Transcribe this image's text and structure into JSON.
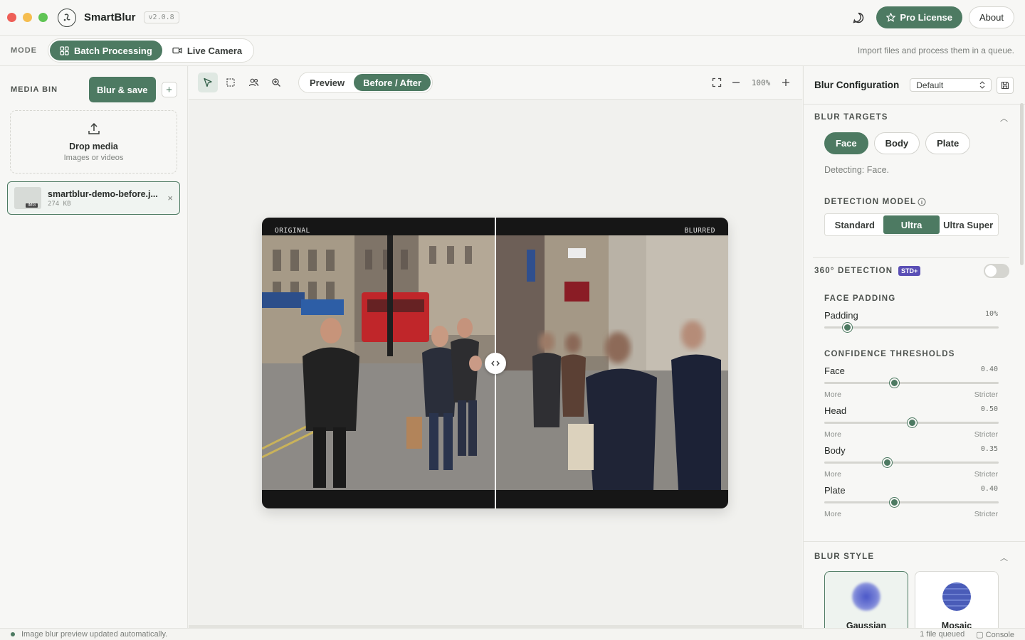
{
  "app": {
    "title": "SmartBlur",
    "version": "v2.0.8"
  },
  "titlebar": {
    "pro_label": "Pro License",
    "about_label": "About"
  },
  "mode": {
    "label": "MODE",
    "tabs": [
      {
        "label": "Batch Processing",
        "active": true
      },
      {
        "label": "Live Camera",
        "active": false
      }
    ],
    "hint": "Import files and process them in a queue."
  },
  "media_bin": {
    "label": "MEDIA BIN",
    "blur_save_label": "Blur & save",
    "add_label": "+",
    "drop_title": "Drop media",
    "drop_sub": "Images or videos",
    "file": {
      "name": "smartblur-demo-before.j...",
      "size": "274 KB",
      "badge": "IMG"
    }
  },
  "viewer": {
    "view_tabs": [
      {
        "label": "Preview",
        "active": false
      },
      {
        "label": "Before / After",
        "active": true
      }
    ],
    "zoom": "100%",
    "left_label": "ORIGINAL",
    "right_label": "BLURRED"
  },
  "config": {
    "title": "Blur Configuration",
    "preset": "Default",
    "targets": {
      "title": "BLUR TARGETS",
      "items": [
        {
          "label": "Face",
          "active": true
        },
        {
          "label": "Body",
          "active": false
        },
        {
          "label": "Plate",
          "active": false
        }
      ],
      "detecting": "Detecting: Face."
    },
    "model": {
      "title": "DETECTION MODEL",
      "options": [
        {
          "label": "Standard",
          "active": false
        },
        {
          "label": "Ultra",
          "active": true
        },
        {
          "label": "Ultra Super",
          "active": false
        }
      ]
    },
    "detection360": {
      "title": "360° DETECTION",
      "tag": "STD+",
      "enabled": false
    },
    "padding": {
      "title": "FACE PADDING",
      "label": "Padding",
      "value": "10%",
      "fraction": 0.13
    },
    "thresholds": {
      "title": "CONFIDENCE THRESHOLDS",
      "items": [
        {
          "label": "Face",
          "value": "0.40",
          "fraction": 0.4,
          "low": "More",
          "high": "Stricter"
        },
        {
          "label": "Head",
          "value": "0.50",
          "fraction": 0.5,
          "low": "More",
          "high": "Stricter"
        },
        {
          "label": "Body",
          "value": "0.35",
          "fraction": 0.36,
          "low": "More",
          "high": "Stricter"
        },
        {
          "label": "Plate",
          "value": "0.40",
          "fraction": 0.4,
          "low": "More",
          "high": "Stricter"
        }
      ]
    },
    "style": {
      "title": "BLUR STYLE",
      "cards": [
        {
          "label": "Gaussian",
          "active": true
        },
        {
          "label": "Mosaic",
          "active": false
        }
      ]
    }
  },
  "status": {
    "message": "Image blur preview updated automatically.",
    "queue": "1 file queued",
    "console": "Console"
  },
  "colors": {
    "accent": "#4d7a62",
    "tag": "#5a4fb5"
  }
}
